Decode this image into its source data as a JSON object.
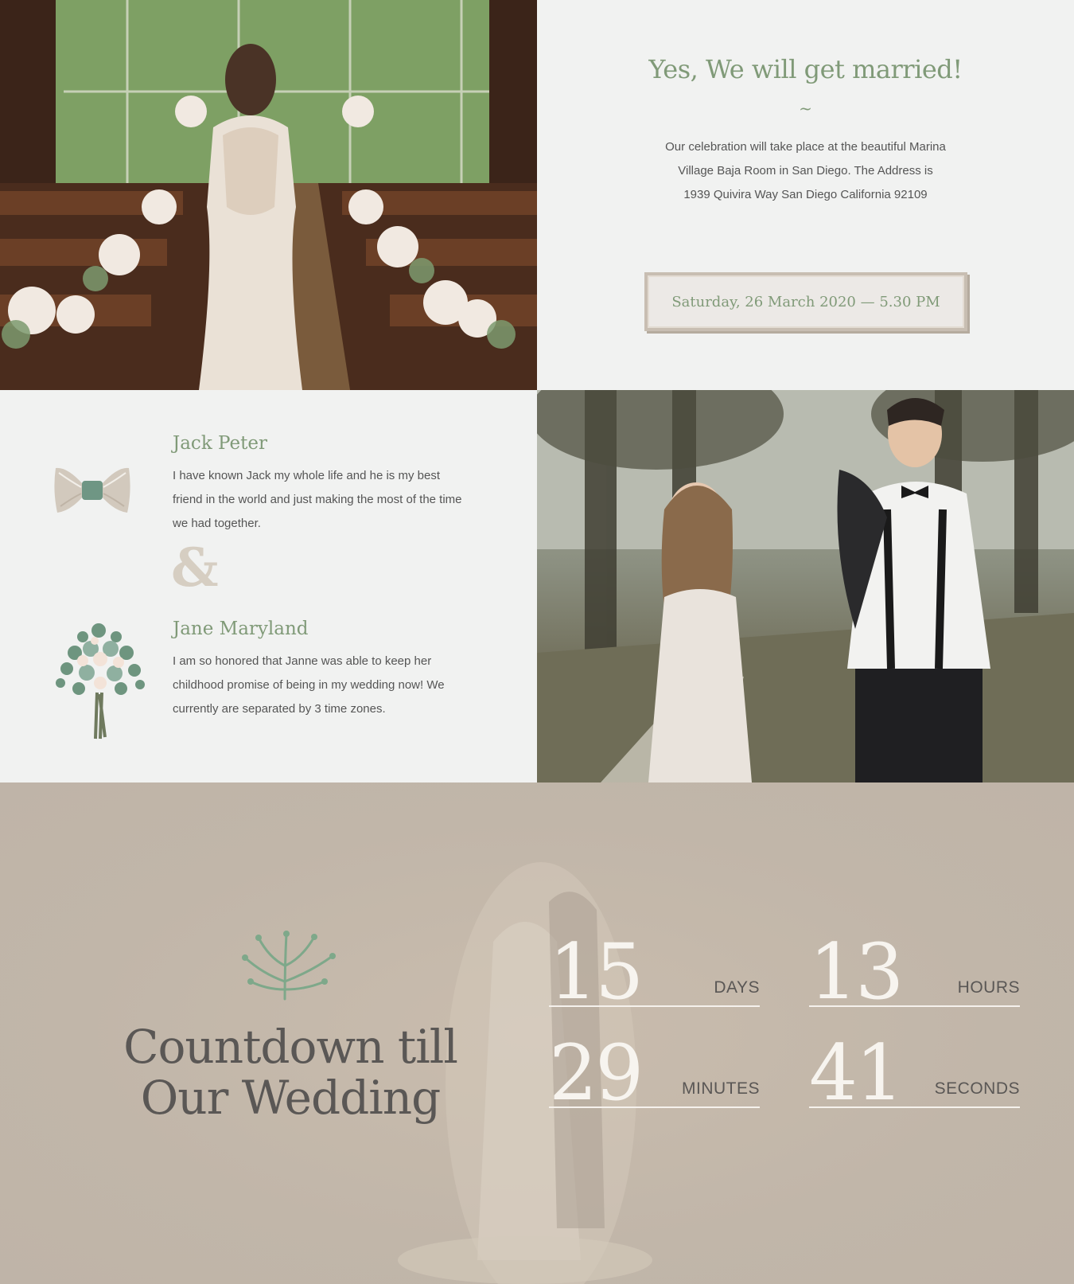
{
  "intro": {
    "title": "Yes, We will get married!",
    "divider": "~",
    "text": "Our celebration will take place at the beautiful Marina Village Baja Room in San Diego. The Address is 1939 Quivira Way San Diego California 92109",
    "date": "Saturday, 26 March 2020 — 5.30 PM"
  },
  "groom": {
    "name": "Jack Peter",
    "bio": "I have known Jack my whole life and he is my best friend in the world and just making the most of the time we had together.",
    "icon": "bowtie-icon"
  },
  "ampersand": "&",
  "bride": {
    "name": "Jane Maryland",
    "bio": "I am so honored that Janne was able to keep her childhood promise of being in my wedding now! We currently are separated by 3 time zones.",
    "icon": "bouquet-icon"
  },
  "countdown": {
    "title": "Countdown till Our Wedding",
    "units": [
      {
        "value": "15",
        "label": "DAYS"
      },
      {
        "value": "13",
        "label": "HOURS"
      },
      {
        "value": "29",
        "label": "MINUTES"
      },
      {
        "value": "41",
        "label": "SECONDS"
      }
    ]
  },
  "colors": {
    "accent": "#809a78",
    "background": "#f1f2f1",
    "countdown_bg": "#c2b7aa",
    "text": "#555555"
  }
}
